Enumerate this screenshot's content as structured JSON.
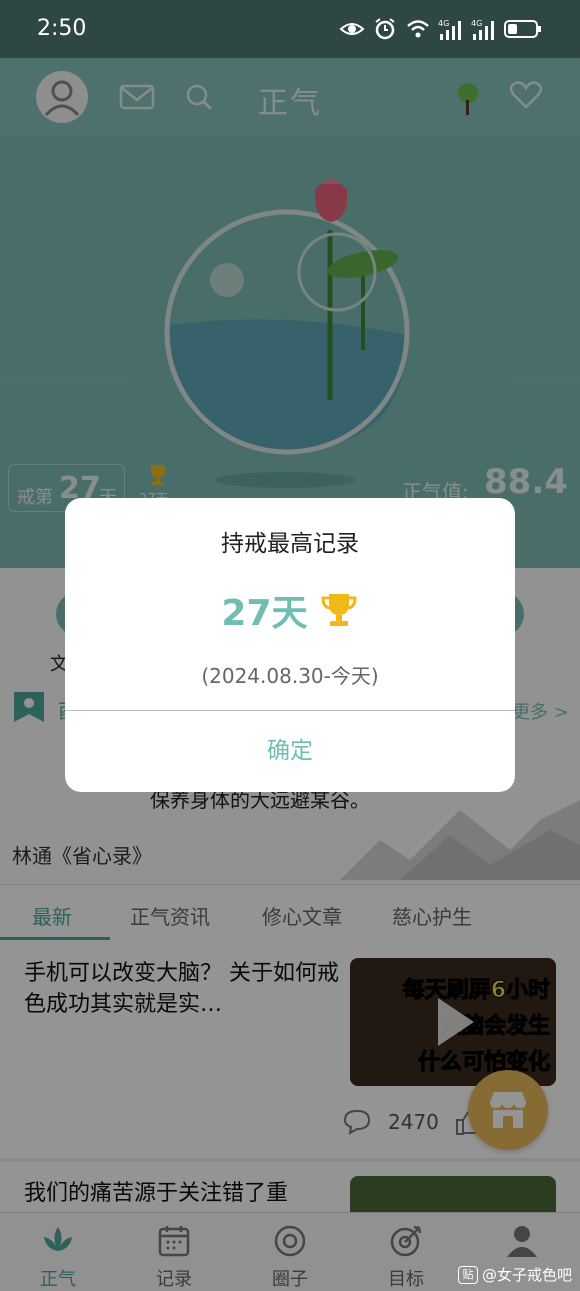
{
  "status_bar": {
    "time": "2:50",
    "icons": [
      "eye-icon",
      "alarm-icon",
      "wifi-icon",
      "signal-4g-icon",
      "signal-4g-icon",
      "battery-icon"
    ]
  },
  "header": {
    "title": "正气",
    "icons": [
      "avatar",
      "mail-icon",
      "search-icon",
      "tree-icon",
      "heart-icon"
    ]
  },
  "hero": {
    "streak_prefix": "戒第",
    "streak_days": "27",
    "streak_suffix": "天",
    "best_record_mini": "27天",
    "zhengqi_label": "正气值:",
    "zhengqi_value": "88.4"
  },
  "panel": {
    "side_text": "文",
    "quote_char": "酉",
    "more_link": "更多 >",
    "quote_line": "保养身体的大远避某谷。",
    "quote_source": "林通《省心录》"
  },
  "tabs": [
    {
      "label": "最新",
      "active": true
    },
    {
      "label": "正气资讯",
      "active": false
    },
    {
      "label": "修心文章",
      "active": false
    },
    {
      "label": "慈心护生",
      "active": false
    }
  ],
  "articles": [
    {
      "title": "手机可以改变大脑？ 关于如何戒色成功其实就是实…",
      "thumb_lines": [
        "每天刷屏6小时",
        "大脑会发生",
        "什么可怕变化"
      ],
      "comments": "2470"
    },
    {
      "title": "我们的痛苦源于关注错了重"
    }
  ],
  "bottom_nav": [
    {
      "label": "正气",
      "icon": "lotus-icon",
      "active": true
    },
    {
      "label": "记录",
      "icon": "calendar-icon",
      "active": false
    },
    {
      "label": "圈子",
      "icon": "circle-icon",
      "active": false
    },
    {
      "label": "目标",
      "icon": "target-icon",
      "active": false
    },
    {
      "label": "我",
      "icon": "person-icon",
      "active": false
    }
  ],
  "watermark": "@女子戒色吧",
  "dialog": {
    "title": "持戒最高记录",
    "days": "27天",
    "date_range": "(2024.08.30-今天)",
    "confirm": "确定"
  },
  "colors": {
    "accent": "#6fbdb3",
    "hero": "#89c3bc",
    "fab": "#e8b85a"
  }
}
